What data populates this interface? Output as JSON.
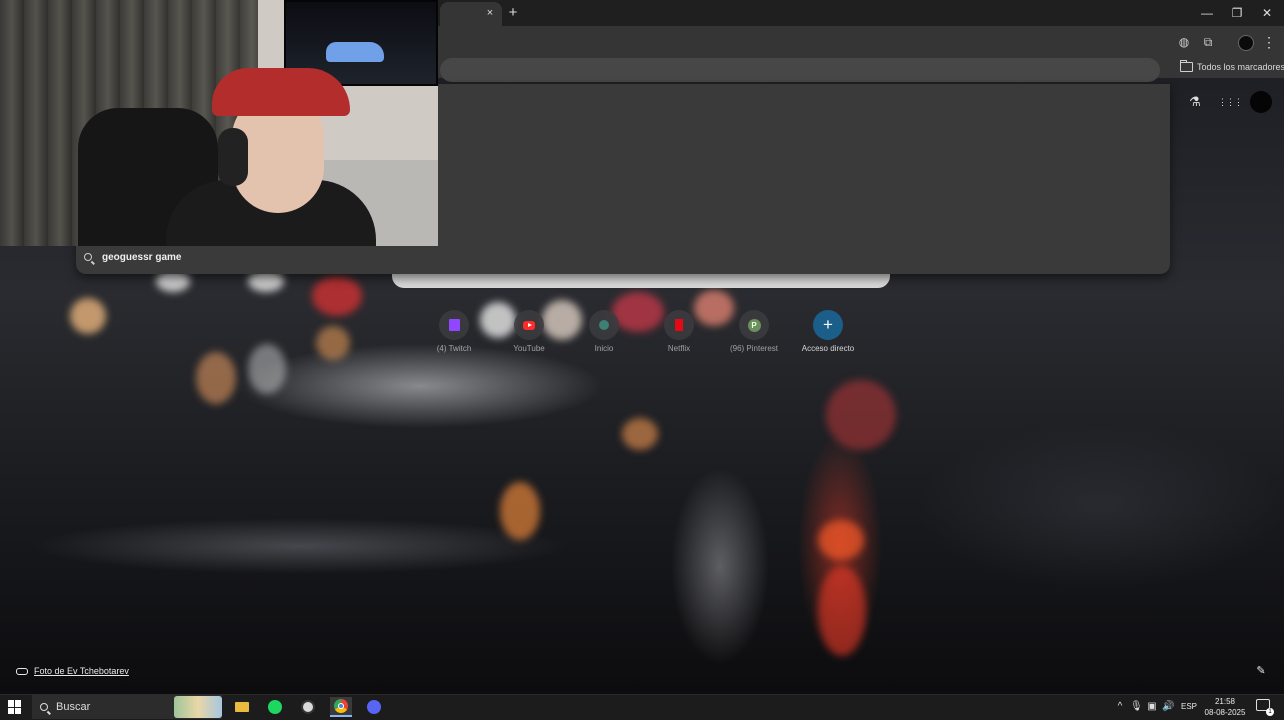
{
  "browser": {
    "tab_close_glyph": "×",
    "new_tab_glyph": "+",
    "window_controls": {
      "minimize": "—",
      "maximize": "❐",
      "close": "✕"
    },
    "menu_glyph": "⋮",
    "bookmarks": {
      "all_bookmarks_label": "Todos los marcadores"
    }
  },
  "omnibox": {
    "suggestions": [
      {
        "text": "geoguessr game",
        "icon": "search-icon"
      }
    ]
  },
  "ntp": {
    "shortcuts": [
      {
        "label": "(4) Twitch",
        "icon": "twitch-icon"
      },
      {
        "label": "YouTube",
        "icon": "youtube-icon"
      },
      {
        "label": "Inicio",
        "icon": "google-icon"
      },
      {
        "label": "Netflix",
        "icon": "netflix-icon"
      },
      {
        "label": "(96) Pinterest",
        "icon": "pinterest-icon",
        "letter": "P"
      },
      {
        "label": "Acceso directo",
        "icon": "plus-icon",
        "glyph": "+"
      }
    ],
    "photo_credit": "Foto de Ev Tchebotarev",
    "edit_glyph": "✎",
    "labs_glyph": "⚗",
    "apps_glyph": "⋮⋮⋮"
  },
  "taskbar": {
    "search_placeholder": "Buscar",
    "language": "ESP",
    "time": "21:58",
    "date": "08-08-2025",
    "tray_chevron": "^",
    "notification_count": "1"
  },
  "colors": {
    "tab_bar": "#1f1f1f",
    "toolbar": "#353535",
    "dropdown": "#3a3a3a",
    "accent_blue": "#1b5e8a",
    "twitch": "#9146ff",
    "youtube": "#ff2b2b",
    "netflix": "#e50914"
  }
}
